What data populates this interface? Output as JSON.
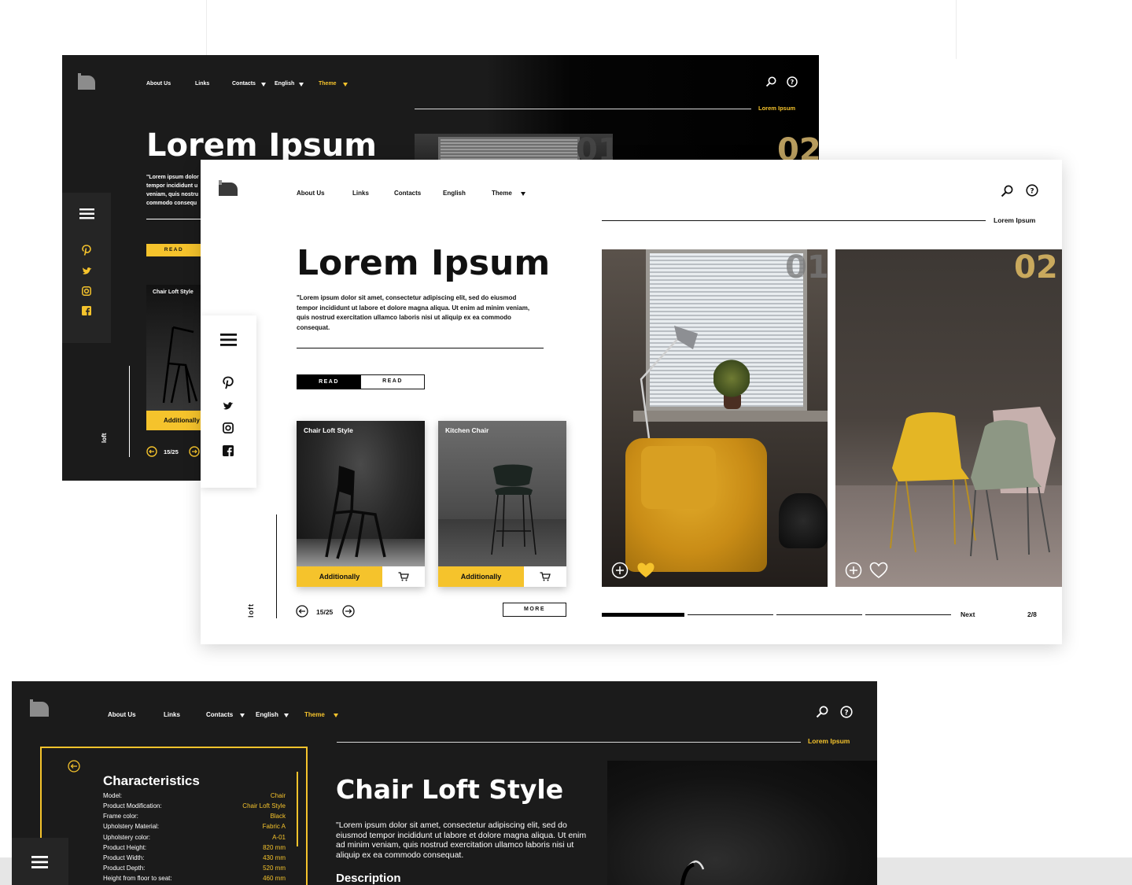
{
  "nav": {
    "about": "About Us",
    "links": "Links",
    "contacts": "Contacts",
    "english": "English",
    "theme": "Theme"
  },
  "hero": {
    "title": "Lorem Ipsum",
    "quote": "\"Lorem ipsum dolor sit amet, consectetur adipiscing elit, sed do eiusmod tempor incididunt ut labore et dolore magna aliqua. Ut enim ad minim veniam, quis nostrud exercitation ullamco laboris nisi ut aliquip ex ea commodo consequat.",
    "read_primary": "READ",
    "read_secondary": "READ",
    "section_label": "Lorem Ipsum"
  },
  "dark_hero": {
    "quote_lines": [
      "\"Lorem ipsum dolor",
      "tempor incididunt u",
      "veniam, quis nostru",
      "commodo consequ"
    ],
    "read": "READ",
    "card_title": "Chair Loft Style",
    "card_button": "Additionally",
    "pager": "15/25"
  },
  "cards": [
    {
      "title": "Chair Loft Style",
      "button": "Additionally"
    },
    {
      "title": "Kitchen Chair",
      "button": "Additionally"
    }
  ],
  "pager": {
    "count": "15/25",
    "more": "MORE"
  },
  "sidebar_label": "loft",
  "gallery": {
    "num1": "01",
    "num2": "02",
    "next": "Next",
    "page": "2/8"
  },
  "detail": {
    "section_label": "Lorem Ipsum",
    "heading": "Characteristics",
    "rows": [
      {
        "k": "Model:",
        "v": "Chair"
      },
      {
        "k": "Product Modification:",
        "v": "Chair Loft Style"
      },
      {
        "k": "Frame color:",
        "v": "Black"
      },
      {
        "k": "Upholstery Material:",
        "v": "Fabric A"
      },
      {
        "k": "Upholstery color:",
        "v": "A-01"
      },
      {
        "k": "Product Height:",
        "v": "820 mm"
      },
      {
        "k": "Product Width:",
        "v": "430 mm"
      },
      {
        "k": "Product Depth:",
        "v": "520 mm"
      },
      {
        "k": "Height from floor to seat:",
        "v": "460 mm"
      }
    ],
    "title": "Chair Loft Style",
    "text": "\"Lorem ipsum dolor sit amet, consectetur adipiscing elit, sed do eiusmod tempor incididunt ut labore et dolore magna aliqua. Ut enim ad minim veniam, quis nostrud exercitation ullamco laboris nisi ut aliquip ex ea commodo consequat.",
    "description": "Description"
  },
  "colors": {
    "accent": "#f5c32c",
    "dark": "#1b1b1b",
    "black": "#000000"
  },
  "icons": [
    "logo-icon",
    "search-icon",
    "help-icon",
    "menu-icon",
    "pinterest-icon",
    "twitter-icon",
    "instagram-icon",
    "facebook-icon",
    "cart-icon",
    "plus-icon",
    "heart-icon",
    "arrow-left-icon",
    "arrow-right-icon"
  ]
}
